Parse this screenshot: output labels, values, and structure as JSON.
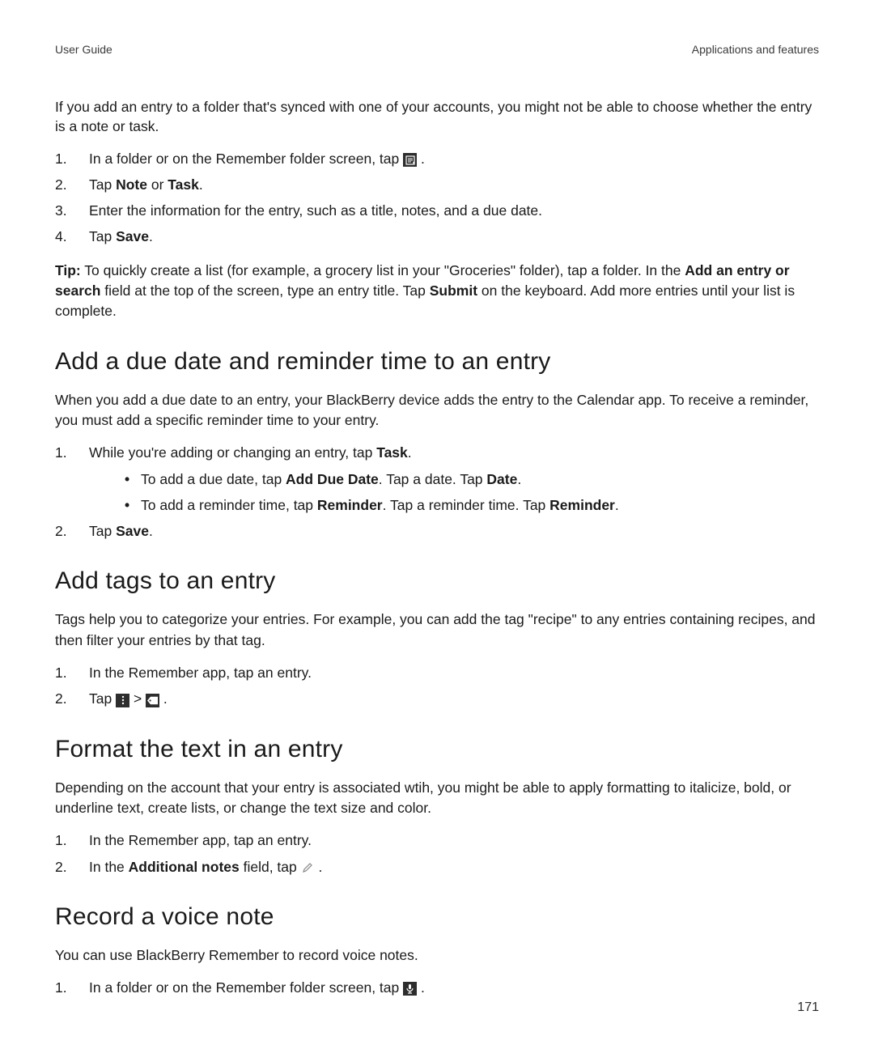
{
  "header": {
    "left": "User Guide",
    "right": "Applications and features"
  },
  "intro": "If you add an entry to a folder that's synced with one of your accounts, you might not be able to choose whether the entry is a note or task.",
  "list_top": {
    "item1_prefix": "In a folder or on the Remember folder screen, tap ",
    "item1_suffix": " .",
    "item2_a": "Tap ",
    "item2_b": "Note",
    "item2_c": " or ",
    "item2_d": "Task",
    "item2_e": ".",
    "item3": "Enter the information for the entry, such as a title, notes, and a due date.",
    "item4_a": "Tap ",
    "item4_b": "Save",
    "item4_c": "."
  },
  "tip": {
    "label": "Tip:",
    "a": " To quickly create a list (for example, a grocery list in your \"Groceries\" folder), tap a folder. In the ",
    "b": "Add an entry or search",
    "c": " field at the top of the screen, type an entry title. Tap ",
    "d": "Submit",
    "e": " on the keyboard. Add more entries until your list is complete."
  },
  "sec_due": {
    "heading": "Add a due date and reminder time to an entry",
    "para": "When you add a due date to an entry, your BlackBerry device adds the entry to the Calendar app. To receive a reminder, you must add a specific reminder time to your entry.",
    "l1_a": "While you're adding or changing an entry, tap ",
    "l1_b": "Task",
    "l1_c": ".",
    "b1_a": "To add a due date, tap ",
    "b1_b": "Add Due Date",
    "b1_c": ". Tap a date. Tap ",
    "b1_d": "Date",
    "b1_e": ".",
    "b2_a": "To add a reminder time, tap ",
    "b2_b": "Reminder",
    "b2_c": ". Tap a reminder time. Tap ",
    "b2_d": "Reminder",
    "b2_e": ".",
    "l2_a": "Tap ",
    "l2_b": "Save",
    "l2_c": "."
  },
  "sec_tags": {
    "heading": "Add tags to an entry",
    "para": "Tags help you to categorize your entries. For example, you can add the tag \"recipe\" to any entries containing recipes, and then filter your entries by that tag.",
    "l1": "In the Remember app, tap an entry.",
    "l2_a": "Tap ",
    "l2_sep": " > ",
    "l2_end": " ."
  },
  "sec_format": {
    "heading": "Format the text in an entry",
    "para": "Depending on the account that your entry is associated wtih, you might be able to apply formatting to italicize, bold, or underline text, create lists, or change the text size and color.",
    "l1": "In the Remember app, tap an entry.",
    "l2_a": "In the ",
    "l2_b": "Additional notes",
    "l2_c": " field, tap ",
    "l2_end": " ."
  },
  "sec_voice": {
    "heading": "Record a voice note",
    "para": "You can use BlackBerry Remember to record voice notes.",
    "l1_a": "In a folder or on the Remember folder screen, tap ",
    "l1_end": " ."
  },
  "page_number": "171"
}
